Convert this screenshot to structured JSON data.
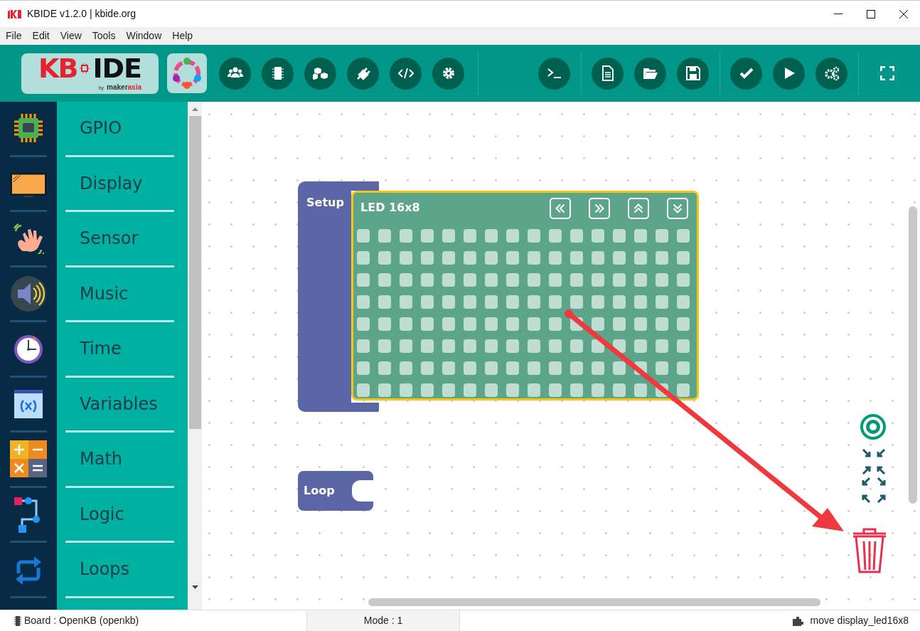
{
  "window": {
    "title": "KBIDE v1.2.0 | kbide.org"
  },
  "menu": [
    "File",
    "Edit",
    "View",
    "Tools",
    "Window",
    "Help"
  ],
  "logo": {
    "main": "KB",
    "suffix": "IDE",
    "byline": "by",
    "brand": "maker",
    "brand_accent": "asia"
  },
  "categories": [
    {
      "label": "GPIO"
    },
    {
      "label": "Display"
    },
    {
      "label": "Sensor"
    },
    {
      "label": "Music"
    },
    {
      "label": "Time"
    },
    {
      "label": "Variables"
    },
    {
      "label": "Math"
    },
    {
      "label": "Logic"
    },
    {
      "label": "Loops"
    }
  ],
  "blocks": {
    "setup": {
      "label": "Setup"
    },
    "led": {
      "title": "LED 16x8",
      "led_rows": [
        {
          "on": [
            false,
            false,
            false,
            false,
            false,
            false,
            false,
            false,
            false,
            false,
            false,
            false,
            false,
            false,
            false,
            false
          ]
        },
        {
          "on": [
            false,
            false,
            false,
            false,
            false,
            false,
            false,
            false,
            false,
            false,
            false,
            false,
            false,
            false,
            false,
            false
          ]
        },
        {
          "on": [
            false,
            false,
            false,
            false,
            false,
            false,
            false,
            false,
            false,
            false,
            false,
            false,
            false,
            false,
            false,
            false
          ]
        },
        {
          "on": [
            false,
            false,
            false,
            false,
            false,
            false,
            false,
            false,
            false,
            false,
            false,
            false,
            false,
            false,
            false,
            false
          ]
        },
        {
          "on": [
            false,
            false,
            false,
            false,
            false,
            false,
            false,
            false,
            false,
            false,
            false,
            false,
            false,
            false,
            false,
            false
          ]
        },
        {
          "on": [
            false,
            false,
            false,
            false,
            false,
            false,
            false,
            false,
            false,
            false,
            false,
            false,
            false,
            false,
            false,
            false
          ]
        },
        {
          "on": [
            false,
            false,
            false,
            false,
            false,
            false,
            false,
            false,
            false,
            false,
            false,
            false,
            false,
            false,
            false,
            false
          ]
        },
        {
          "on": [
            false,
            false,
            false,
            false,
            false,
            false,
            false,
            false,
            false,
            false,
            false,
            false,
            false,
            false,
            false,
            false
          ]
        }
      ]
    },
    "loop": {
      "label": "Loop"
    }
  },
  "status_bar": {
    "board": "Board : OpenKB (openkb)",
    "mode": "Mode : 1",
    "action": "move display_led16x8"
  }
}
